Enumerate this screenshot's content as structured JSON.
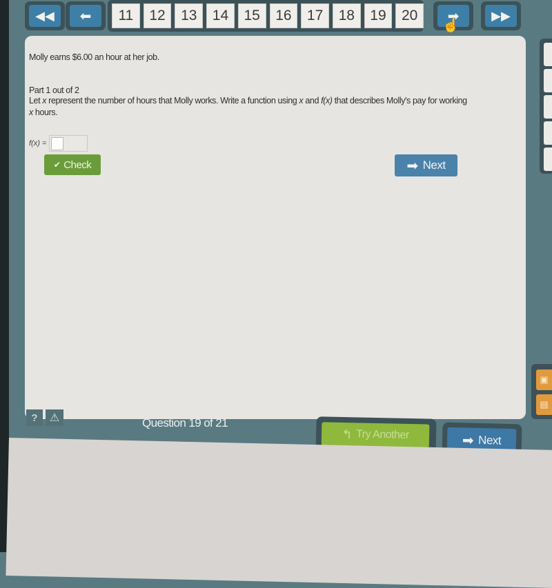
{
  "nav": {
    "first_icon": "double-left-arrow-icon",
    "prev_icon": "left-arrow-icon",
    "next_icon": "right-arrow-icon",
    "last_icon": "double-right-arrow-icon",
    "pages": [
      "11",
      "12",
      "13",
      "14",
      "15",
      "16",
      "17",
      "18",
      "19",
      "20"
    ]
  },
  "question": {
    "intro": "Molly earns $6.00 an hour at her job.",
    "part": "Part 1 out of 2",
    "prompt_a": "Let ",
    "var_x": "x",
    "prompt_b": " represent the number of hours that Molly works. Write a function using ",
    "var_x2": "x",
    "prompt_c": " and ",
    "var_fx": "f(x)",
    "prompt_d": " that describes Molly's pay for working ",
    "var_x3": "x",
    "prompt_e": " hours.",
    "answer_label": "f(x) =",
    "answer_value": ""
  },
  "buttons": {
    "check": "Check",
    "check_icon": "✔",
    "next_inline": "Next",
    "try_another": "Try Another",
    "try_icon": "↰",
    "next": "Next"
  },
  "footer": {
    "help": "?",
    "warn": "⚠",
    "status": "Question 19 of 21"
  },
  "colors": {
    "nav_blue": "#3e7fa8",
    "check_green": "#6b9c3a",
    "try_green": "#8fb93c",
    "frame_teal": "#5a7a82",
    "side_orange": "#e19a3e"
  }
}
